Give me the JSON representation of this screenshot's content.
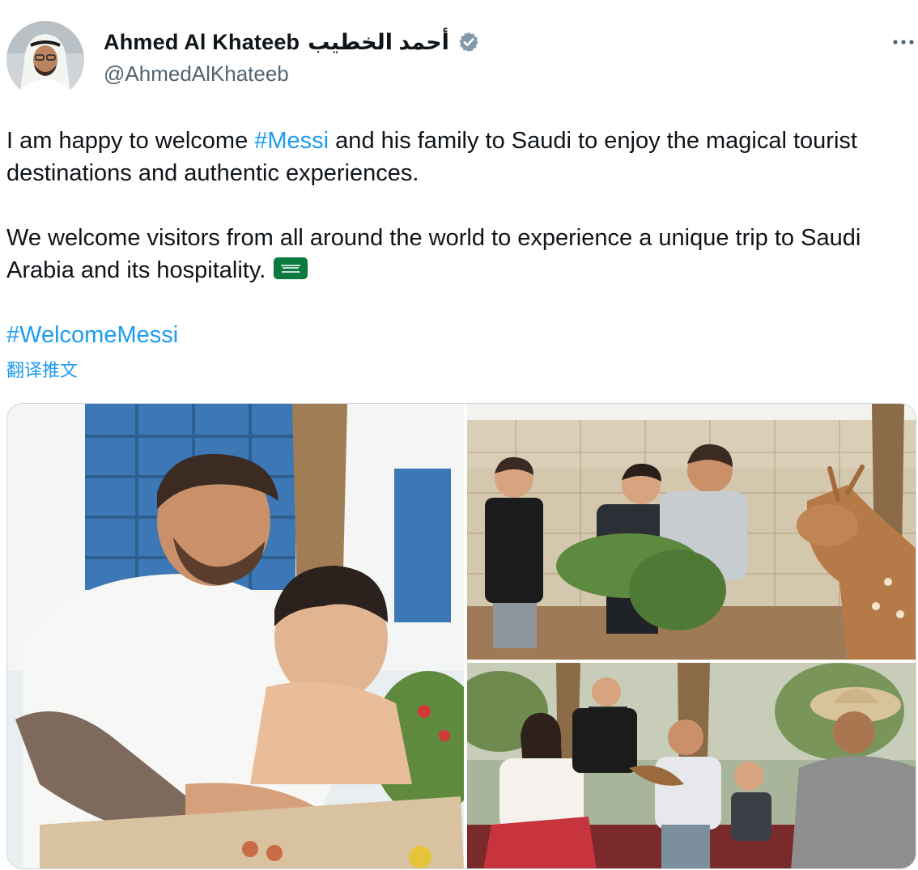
{
  "tweet": {
    "author": {
      "display_name": "Ahmed Al Khateeb",
      "display_name_arabic": "أحمد الخطيب",
      "handle": "@AhmedAlKhateeb",
      "verified": true,
      "verified_badge_color": "#829aab"
    },
    "text": {
      "p1_before": "I am happy to welcome ",
      "p1_hashtag": "#Messi",
      "p1_after": " and his family to Saudi to enjoy the magical tourist destinations and authentic experiences.",
      "p2": "We welcome visitors from all around the world to experience a unique trip to Saudi Arabia and its hospitality.",
      "p2_emoji": "saudi-arabia-flag",
      "p3_hashtag": "#WelcomeMessi"
    },
    "translate_label": "翻译推文",
    "media": {
      "count": 3
    }
  },
  "colors": {
    "link": "#1d9bf0",
    "text": "#0f1419",
    "secondary_text": "#536471",
    "border": "#cfd9de"
  }
}
